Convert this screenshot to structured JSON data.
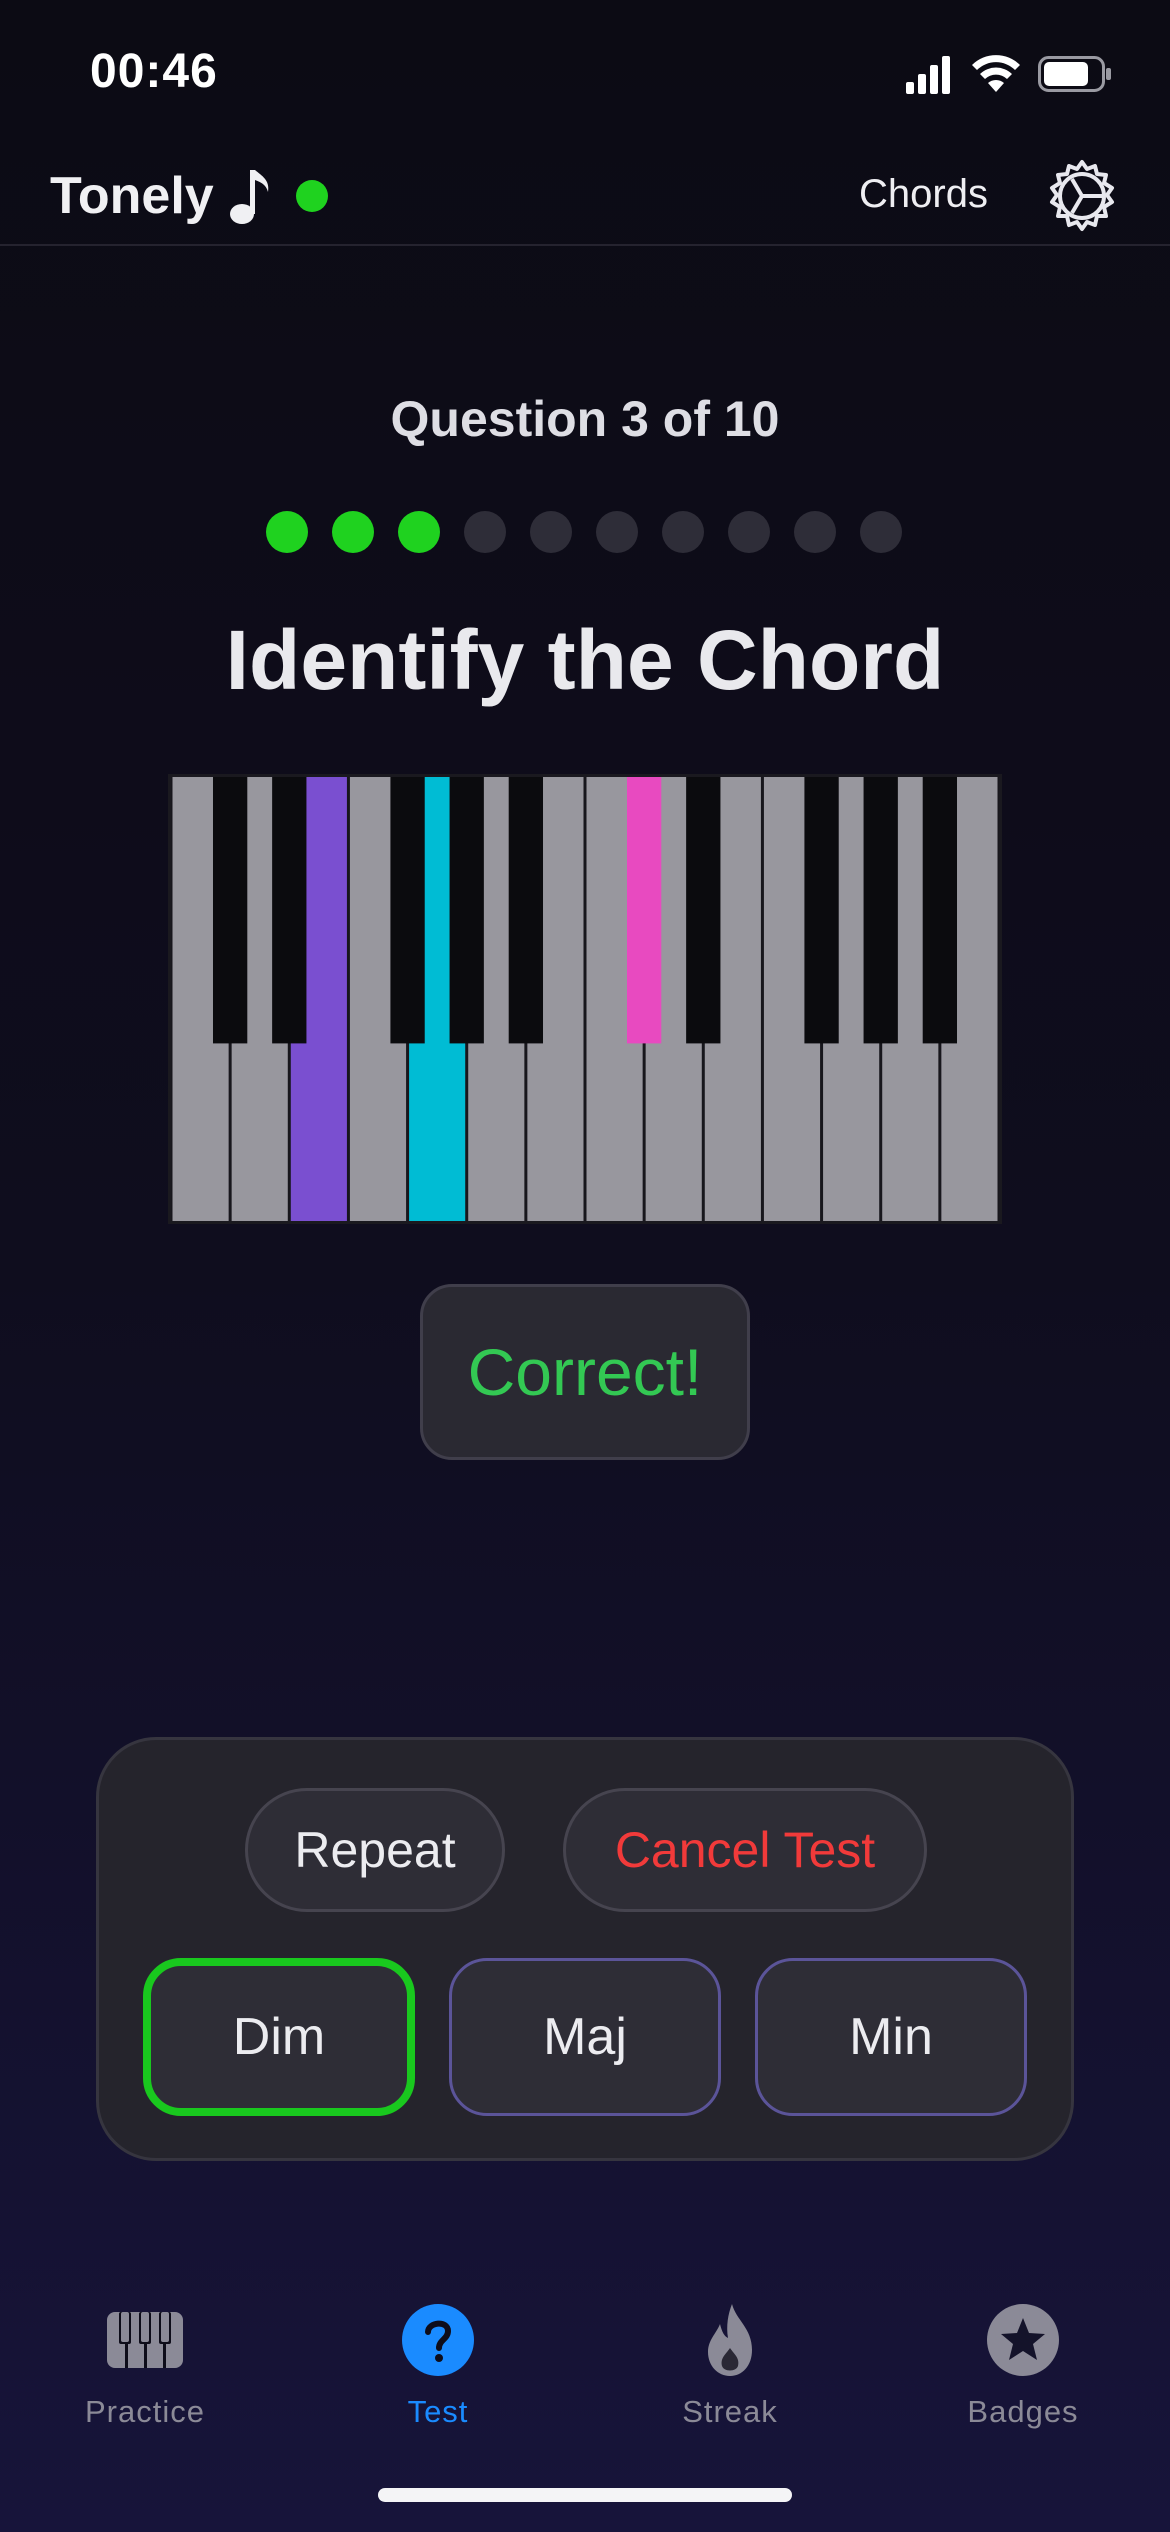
{
  "status_bar": {
    "time": "00:46"
  },
  "header": {
    "app_title": "Tonely",
    "mode_label": "Chords",
    "live_indicator_color": "#1fd21f"
  },
  "question": {
    "counter": "Question 3 of 10",
    "current": 3,
    "total": 10,
    "completed": 3,
    "prompt": "Identify the Chord"
  },
  "piano": {
    "white_key_count": 14,
    "highlighted_white_keys": [
      {
        "index": 2,
        "color": "#7a4fd0"
      },
      {
        "index": 4,
        "color": "#00bcd4"
      }
    ],
    "highlighted_black_keys": [
      {
        "index": 5,
        "color": "#e84ac0"
      }
    ]
  },
  "feedback": {
    "text": "Correct!",
    "color": "#33c853"
  },
  "actions": {
    "repeat_label": "Repeat",
    "cancel_label": "Cancel Test"
  },
  "choices": [
    {
      "label": "Dim",
      "state": "correct"
    },
    {
      "label": "Maj",
      "state": "default"
    },
    {
      "label": "Min",
      "state": "default"
    }
  ],
  "tabs": [
    {
      "label": "Practice",
      "icon": "piano-icon",
      "active": false
    },
    {
      "label": "Test",
      "icon": "question-icon",
      "active": true
    },
    {
      "label": "Streak",
      "icon": "flame-icon",
      "active": false
    },
    {
      "label": "Badges",
      "icon": "star-badge-icon",
      "active": false
    }
  ],
  "colors": {
    "accent_green": "#1fd21f",
    "active_tab_blue": "#1a8bff",
    "cancel_red": "#f13a3a",
    "choice_border": "#5b5499"
  }
}
